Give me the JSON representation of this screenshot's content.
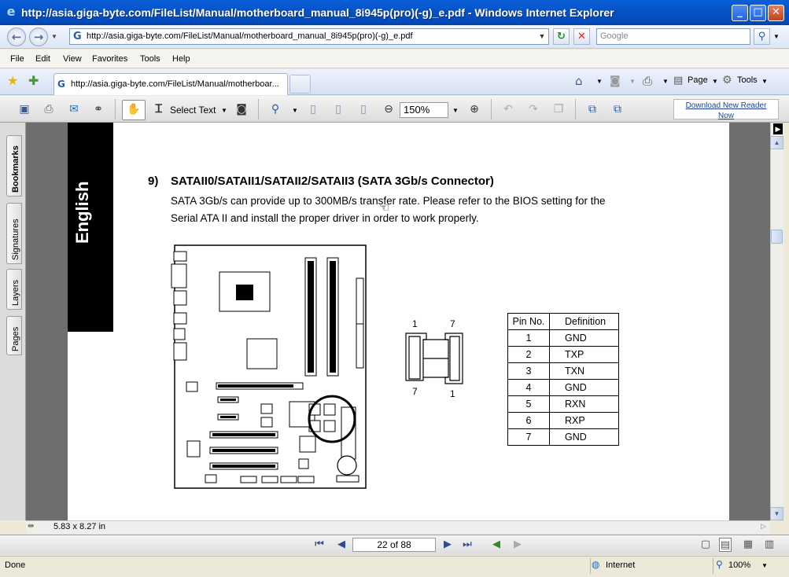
{
  "window": {
    "title": "http://asia.giga-byte.com/FileList/Manual/motherboard_manual_8i945p(pro)(-g)_e.pdf - Windows Internet Explorer",
    "minimize_glyph": "_",
    "maximize_glyph": "□",
    "close_glyph": "✕"
  },
  "address_bar": {
    "url": "http://asia.giga-byte.com/FileList/Manual/motherboard_manual_8i945p(pro)(-g)_e.pdf",
    "search_placeholder": "Google"
  },
  "menu": [
    "File",
    "Edit",
    "View",
    "Favorites",
    "Tools",
    "Help"
  ],
  "tab": {
    "title": "http://asia.giga-byte.com/FileList/Manual/motherboar..."
  },
  "command_bar": {
    "page_label": "Page",
    "tools_label": "Tools"
  },
  "pdf_toolbar": {
    "select_text_label": "Select Text",
    "zoom_value": "150%",
    "download_reader_line1": "Download New Reader",
    "download_reader_line2": "Now"
  },
  "nav_panel": {
    "tabs": [
      "Bookmarks",
      "Signatures",
      "Layers",
      "Pages"
    ]
  },
  "document": {
    "language_band": "English",
    "section_number": "9)",
    "section_title": "SATAII0/SATAII1/SATAII2/SATAII3 (SATA 3Gb/s Connector)",
    "description_line1": "SATA 3Gb/s can provide up to 300MB/s transfer rate. Please refer to the BIOS setting for the",
    "description_line2": "Serial ATA II and install the proper driver in order to work properly.",
    "connector_labels": {
      "top_left": "1",
      "top_right": "7",
      "bottom_left": "7",
      "bottom_right": "1"
    },
    "pin_table": {
      "headers": [
        "Pin No.",
        "Definition"
      ],
      "rows": [
        [
          "1",
          "GND"
        ],
        [
          "2",
          "TXP"
        ],
        [
          "3",
          "TXN"
        ],
        [
          "4",
          "GND"
        ],
        [
          "5",
          "RXN"
        ],
        [
          "6",
          "RXP"
        ],
        [
          "7",
          "GND"
        ]
      ]
    }
  },
  "page_size": "5.83 x 8.27 in",
  "page_nav": {
    "page_indicator": "22 of 88"
  },
  "status_bar": {
    "status": "Done",
    "zone": "Internet",
    "zoom": "100%"
  },
  "colors": {
    "titlebar": "#0553c8",
    "document_background": "#6e6e6e",
    "language_band": "#000000"
  }
}
